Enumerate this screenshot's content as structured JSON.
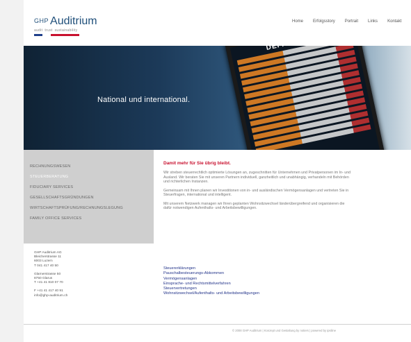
{
  "logo": {
    "prefix": "GHP",
    "name": "Auditrium",
    "tagline": [
      "audit",
      "trust",
      "sustainability"
    ]
  },
  "nav": [
    "Home",
    "Erfolgsstory",
    "Portrait",
    "Links",
    "Kontakt"
  ],
  "hero": {
    "text": "National und international.",
    "board_title": "DEPARTURES"
  },
  "sidebar": {
    "items": [
      "RECHNUNGSWESEN",
      "STEUERBERATUNG",
      "FIDUCIARY SERVICES",
      "GESELLSCHAFTSGRÜNDUNGEN",
      "WIRTSCHAFTSPRÜFUNG/RECHNUNGSLEGUNG",
      "FAMILY OFFICE SERVICES"
    ],
    "active_index": 1
  },
  "address": [
    "GHP Auditrium AG",
    "Bleicherstrasse 11",
    "6003 Luzern",
    "T 041 417 40 50",
    "",
    "Glarnerstrasse 50",
    "8750 Glarus",
    "T +41 41 810 07 70",
    "",
    "F +41 41 417 40 91",
    "info@ghp-auditrium.ch"
  ],
  "content": {
    "headline": "Damit mehr für Sie übrig bleibt.",
    "paragraphs": [
      "Wir streben steuerrechtlich optimierte Lösungen an, zugeschnitten für Unternehmen und Privatpersonen im In- und Ausland. Wir beraten Sie mit unseren Partnern individuell, ganzheitlich und unabhängig, verhandeln mit Behörden und richterlichen Instanzen.",
      "Gemeinsam mit Ihnen planen wir Investitionen von in- und ausländischen Vermögensanlagen und vertreten Sie in Steuerfragen, international und intelligent.",
      "Mit unserem Netzwerk managen wir Ihren geplanten Wohnsitzwechsel länderübergreifend und organisieren die dafür notwendigen Aufenthalts- und Arbeitsbewilligungen."
    ]
  },
  "links": [
    "Steuererklärungen",
    "Pauschalbesteuerungs-Abkommen",
    "Vermögensanlagen",
    "Einsprache- und Rechtsmittelverfahren",
    "Steuervertretungen",
    "Wohnsitzwechsel/Aufenthalts- und Arbeitsbewilligungen"
  ],
  "footer": "© 2008 GHP Auditrium | Konzept und Gestaltung by notiers | powered by ipsiline",
  "colors": {
    "brand_blue": "#1f4f7a",
    "accent_red": "#c8102e",
    "link_blue": "#23348a",
    "sidebar_bg": "#cfcfcf"
  }
}
